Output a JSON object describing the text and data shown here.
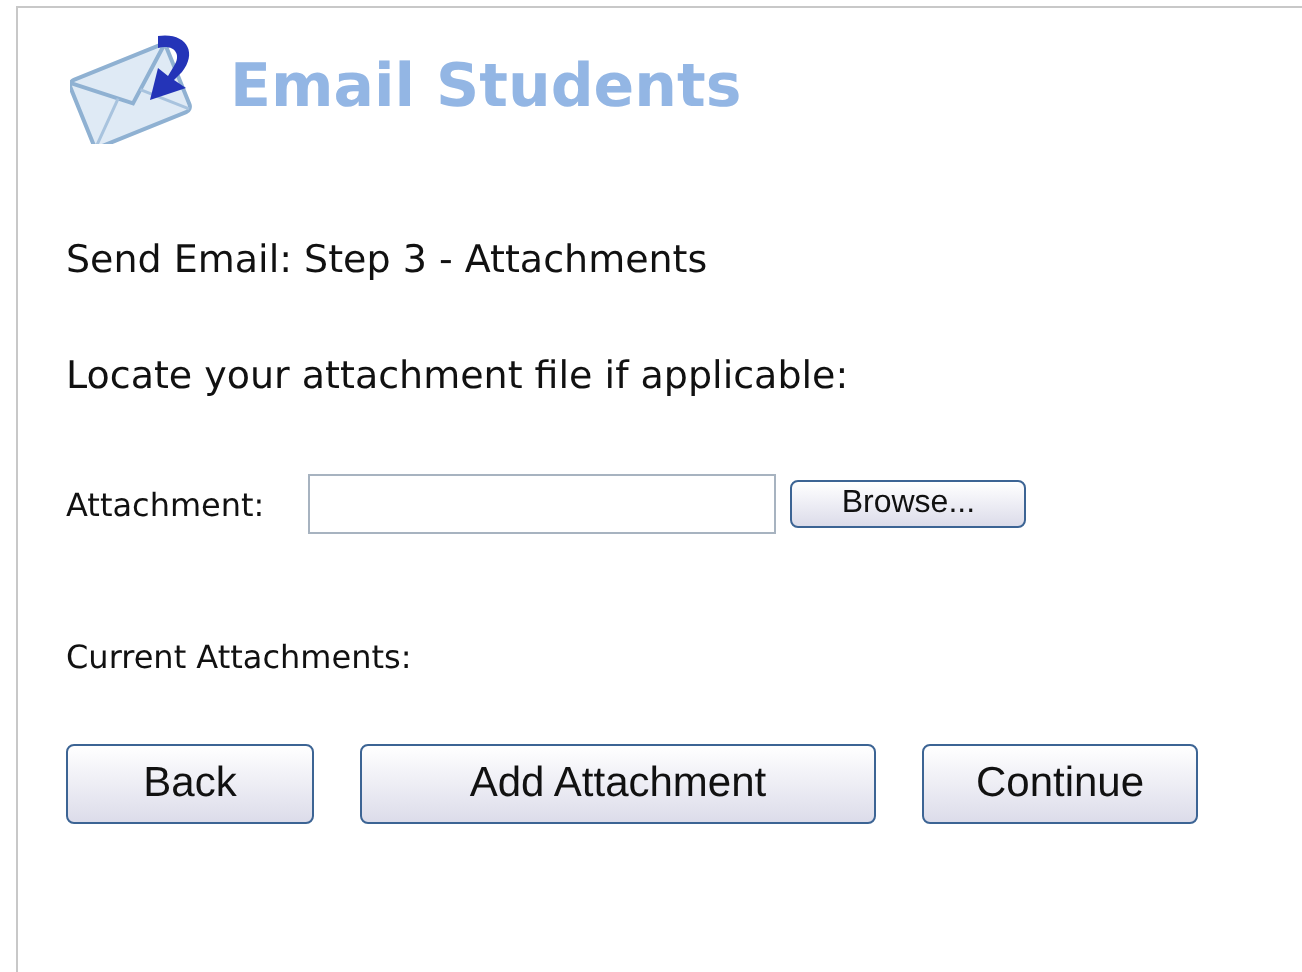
{
  "header": {
    "title": "Email Students"
  },
  "step_title": "Send Email: Step 3 - Attachments",
  "instruction": "Locate your attachment file if applicable:",
  "attachment": {
    "label": "Attachment:",
    "browse_button": "Browse..."
  },
  "current_attachments_label": "Current Attachments:",
  "buttons": [
    {
      "label": "Back",
      "kind": "back"
    },
    {
      "label": "Add Attachment",
      "kind": "add"
    },
    {
      "label": "Continue",
      "kind": "continue"
    }
  ]
}
